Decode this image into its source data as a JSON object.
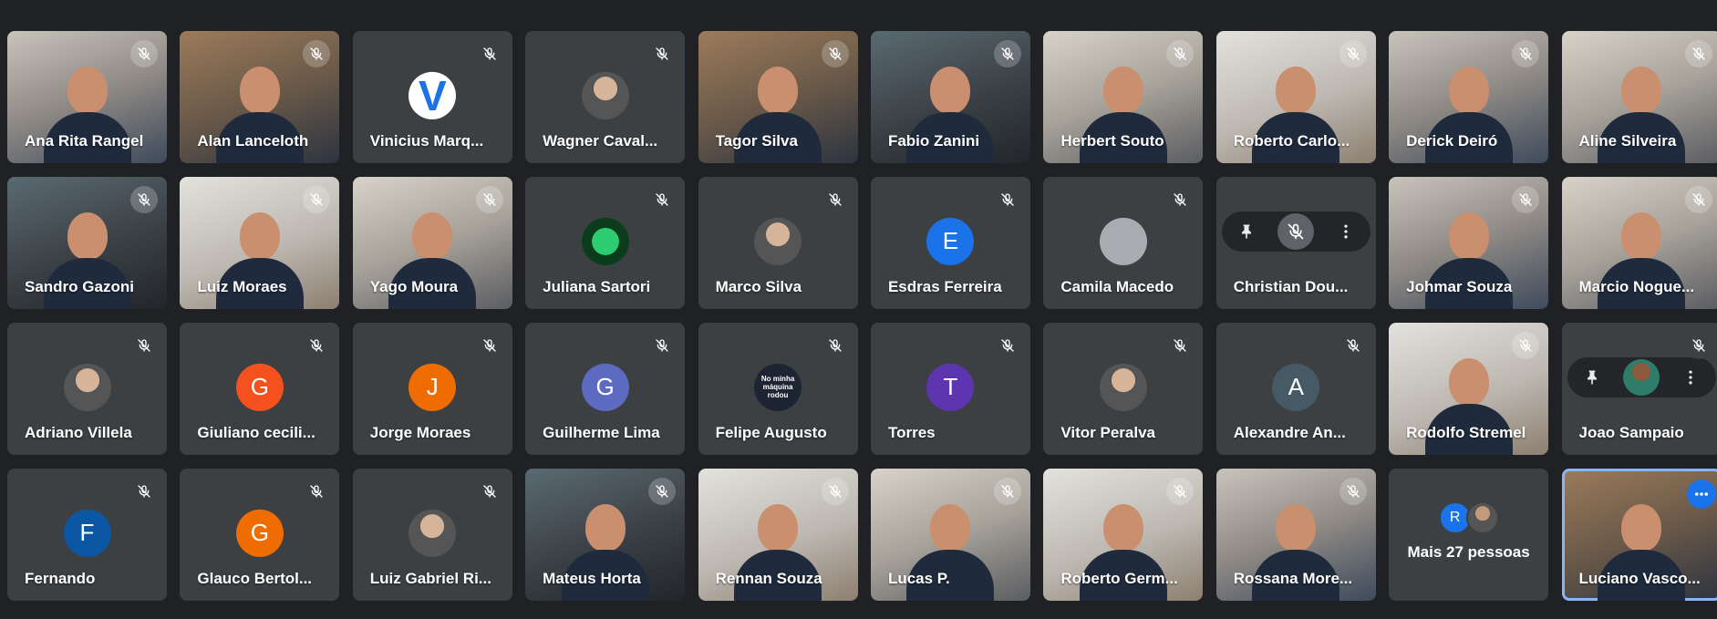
{
  "colors": {
    "background": "#202124",
    "tile": "#3c4043",
    "selected_border": "#8ab4f8",
    "accent_blue": "#1a73e8"
  },
  "icons": {
    "mic_off": "mic-off-icon",
    "pin": "pin-icon",
    "more": "more-vert-icon",
    "options": "more-horiz-icon"
  },
  "participants": [
    {
      "name": "Ana Rita Rangel",
      "kind": "video",
      "style": "v1"
    },
    {
      "name": "Alan Lanceloth",
      "kind": "video",
      "style": "v2"
    },
    {
      "name": "Vinicius Marq...",
      "kind": "avatar",
      "avatar": "V",
      "avatar_style": "v-logo"
    },
    {
      "name": "Wagner Caval...",
      "kind": "avatar",
      "avatar": "",
      "avatar_style": "pic"
    },
    {
      "name": "Tagor Silva",
      "kind": "video",
      "style": "v2"
    },
    {
      "name": "Fabio Zanini",
      "kind": "video",
      "style": "v4"
    },
    {
      "name": "Herbert Souto",
      "kind": "video",
      "style": "v3"
    },
    {
      "name": "Roberto Carlo...",
      "kind": "video",
      "style": "v5"
    },
    {
      "name": "Derick Deiró",
      "kind": "video",
      "style": "v1"
    },
    {
      "name": "Aline Silveira",
      "kind": "video",
      "style": "v3"
    },
    {
      "name": "Sandro Gazoni",
      "kind": "video",
      "style": "v4"
    },
    {
      "name": "Luiz Moraes",
      "kind": "video",
      "style": "v5"
    },
    {
      "name": "Yago Moura",
      "kind": "video",
      "style": "v3"
    },
    {
      "name": "Juliana Sartori",
      "kind": "avatar",
      "avatar": "",
      "avatar_style": "green"
    },
    {
      "name": "Marco Silva",
      "kind": "avatar",
      "avatar": "",
      "avatar_style": "pic"
    },
    {
      "name": "Esdras Ferreira",
      "kind": "avatar",
      "avatar": "E",
      "bg": "#1a73e8"
    },
    {
      "name": "Camila Macedo",
      "kind": "avatar",
      "avatar": "",
      "avatar_style": "gray-person"
    },
    {
      "name": "Christian Dou...",
      "kind": "hover"
    },
    {
      "name": "Johmar Souza",
      "kind": "video",
      "style": "v1"
    },
    {
      "name": "Marcio Nogue...",
      "kind": "video",
      "style": "v3"
    },
    {
      "name": "Adriano Villela",
      "kind": "avatar",
      "avatar": "",
      "avatar_style": "pic"
    },
    {
      "name": "Giuliano cecili...",
      "kind": "avatar",
      "avatar": "G",
      "bg": "#f4511e"
    },
    {
      "name": "Jorge Moraes",
      "kind": "avatar",
      "avatar": "J",
      "bg": "#ef6c00"
    },
    {
      "name": "Guilherme Lima",
      "kind": "avatar",
      "avatar": "G",
      "bg": "#5c6bc0"
    },
    {
      "name": "Felipe Augusto",
      "kind": "avatar",
      "avatar": "No minha máquina rodou",
      "avatar_style": "dark-text"
    },
    {
      "name": "Torres",
      "kind": "avatar",
      "avatar": "T",
      "bg": "#5e35b1"
    },
    {
      "name": "Vitor Peralva",
      "kind": "avatar",
      "avatar": "",
      "avatar_style": "pic"
    },
    {
      "name": "Alexandre An...",
      "kind": "avatar",
      "avatar": "A",
      "bg": "#455a64"
    },
    {
      "name": "Rodolfo Stremel",
      "kind": "video",
      "style": "v5"
    },
    {
      "name": "Joao Sampaio",
      "kind": "hover-pin"
    },
    {
      "name": "Fernando",
      "kind": "avatar",
      "avatar": "F",
      "bg": "#0b57a3"
    },
    {
      "name": "Glauco Bertol...",
      "kind": "avatar",
      "avatar": "G",
      "bg": "#ef6c00"
    },
    {
      "name": "Luiz Gabriel Ri...",
      "kind": "avatar",
      "avatar": "",
      "avatar_style": "pic"
    },
    {
      "name": "Mateus Horta",
      "kind": "video",
      "style": "v4"
    },
    {
      "name": "Rennan Souza",
      "kind": "video",
      "style": "v5"
    },
    {
      "name": "Lucas P.",
      "kind": "video",
      "style": "v3"
    },
    {
      "name": "Roberto Germ...",
      "kind": "video",
      "style": "v5"
    },
    {
      "name": "Rossana More...",
      "kind": "video",
      "style": "v1"
    },
    {
      "name": "Mais 27 pessoas",
      "kind": "more",
      "mini_avatar": "R",
      "mini_bg": "#1a73e8"
    },
    {
      "name": "Luciano Vasco...",
      "kind": "self",
      "style": "v2"
    }
  ]
}
